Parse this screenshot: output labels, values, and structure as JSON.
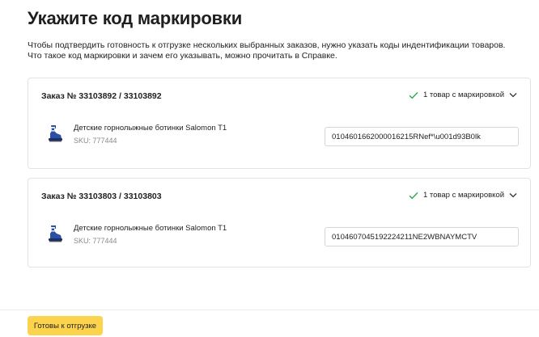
{
  "page": {
    "title": "Укажите код маркировки",
    "description": "Чтобы подтвердить готовность к отгрузке нескольких выбранных заказов, нужно указать коды индентификации товаров. Что такое код маркировки и зачем его указывать, можно прочитать в Справке."
  },
  "orders": [
    {
      "title": "Заказ № 33103892 / 33103892",
      "status": "1 товар с маркировкой",
      "product_name": "Детские горнолыжные ботинки Salomon T1",
      "sku": "SKU: 777444",
      "code_value": "0104601662000016215RNef*\\u001d93B0lk"
    },
    {
      "title": "Заказ № 33103803 / 33103803",
      "status": "1 товар с маркировкой",
      "product_name": "Детские горнолыжные ботинки Salomon T1",
      "sku": "SKU: 777444",
      "code_value": "0104607045192224211NE2WBNAYMCTV"
    }
  ],
  "footer": {
    "ready_label": "Готовы к отгрузке"
  },
  "colors": {
    "accent_button": "#fcd34c",
    "check": "#2fa84f",
    "boot": "#2a4fa3"
  },
  "icons": [
    "check-icon",
    "chevron-down-icon",
    "ski-boot-icon"
  ]
}
